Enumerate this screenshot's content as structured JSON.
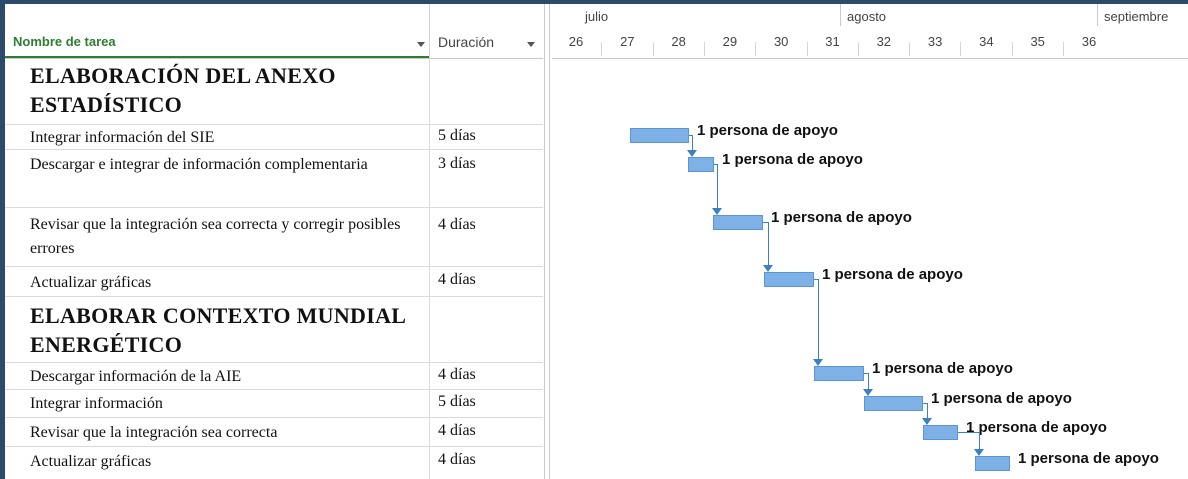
{
  "columns": {
    "task_name": "Nombre de tarea",
    "duration": "Duración"
  },
  "timescale": {
    "months": [
      "julio",
      "agosto",
      "septiembre"
    ],
    "weeks": [
      "26",
      "27",
      "28",
      "29",
      "30",
      "31",
      "32",
      "33",
      "34",
      "35",
      "36"
    ]
  },
  "rows": [
    {
      "type": "summary",
      "name": "ELABORACIÓN DEL ANEXO ESTADÍSTICO",
      "duration": ""
    },
    {
      "type": "task",
      "name": "Integrar información del SIE",
      "duration": "5 días",
      "resource": "1 persona de apoyo"
    },
    {
      "type": "task",
      "name": "Descargar e integrar de información complementaria",
      "duration": "3 días",
      "resource": "1 persona de apoyo"
    },
    {
      "type": "task",
      "name": "Revisar que la integración sea correcta y corregir posibles errores",
      "duration": "4 días",
      "resource": "1 persona de apoyo"
    },
    {
      "type": "task",
      "name": "Actualizar gráficas",
      "duration": "4 días",
      "resource": "1 persona de apoyo"
    },
    {
      "type": "summary",
      "name": "ELABORAR CONTEXTO MUNDIAL ENERGÉTICO",
      "duration": ""
    },
    {
      "type": "task",
      "name": "Descargar información de la AIE",
      "duration": "4 días",
      "resource": "1 persona de apoyo"
    },
    {
      "type": "task",
      "name": "Integrar información",
      "duration": "5 días",
      "resource": "1 persona de apoyo"
    },
    {
      "type": "task",
      "name": "Revisar que la integración sea correcta",
      "duration": "4 días",
      "resource": "1 persona de apoyo"
    },
    {
      "type": "task",
      "name": "Actualizar gráficas",
      "duration": "4 días",
      "resource": "1 persona de apoyo"
    }
  ],
  "colors": {
    "bar": "#7eb2e6",
    "link": "#3b7fc4",
    "header_accent": "#2e7d32"
  }
}
